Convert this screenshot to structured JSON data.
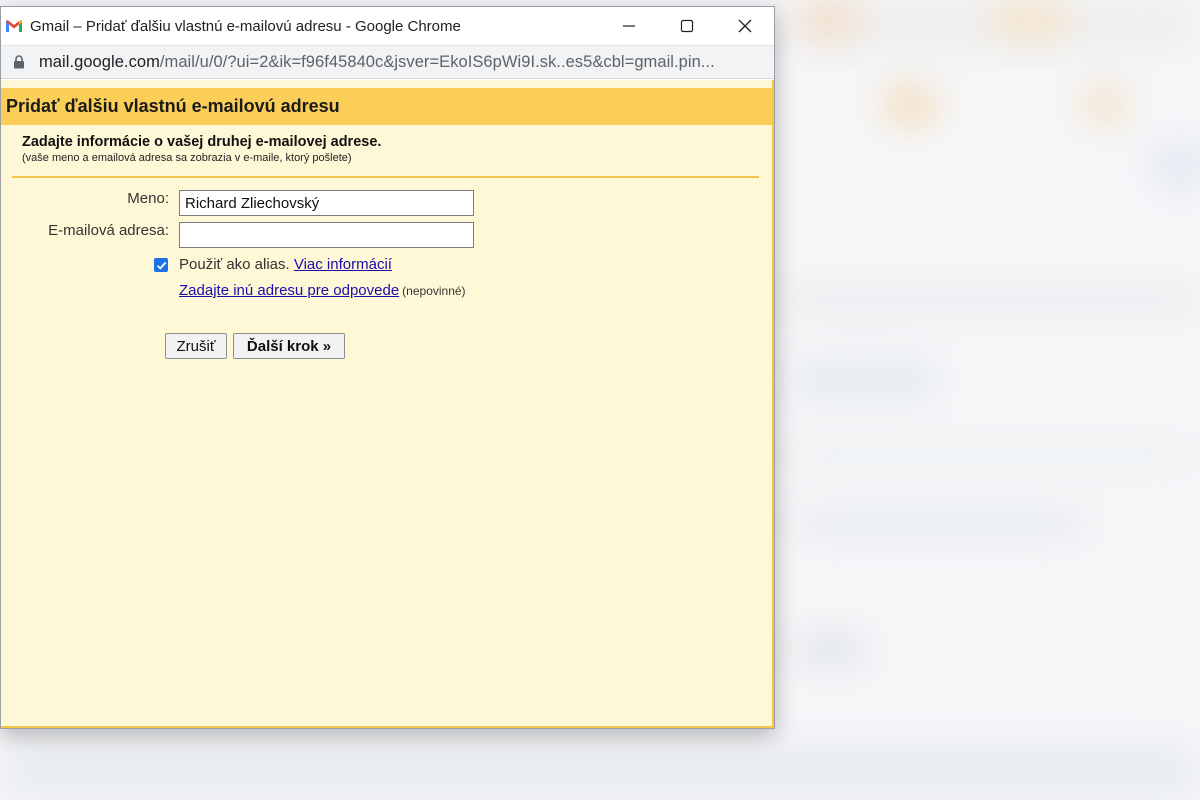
{
  "window": {
    "title": "Gmail – Pridať ďalšiu vlastnú e-mailovú adresu - Google Chrome",
    "url_host": "mail.google.com",
    "url_path": "/mail/u/0/?ui=2&ik=f96f45840c&jsver=EkoIS6pWi9I.sk..es5&cbl=gmail.pin...",
    "icons": [
      "gmail-icon",
      "minimize-icon",
      "maximize-icon",
      "close-icon",
      "lock-icon"
    ]
  },
  "dialog": {
    "header": "Pridať ďalšiu vlastnú e-mailovú adresu",
    "intro_title": "Zadajte informácie o vašej druhej e-mailovej adrese.",
    "intro_sub": "(vaše meno a emailová adresa sa zobrazia v e-maile, ktorý pošlete)",
    "name_label": "Meno:",
    "name_value": "Richard Zliechovský",
    "email_label": "E-mailová adresa:",
    "email_value": "",
    "alias_checked": true,
    "alias_label": "Použiť ako alias.",
    "alias_link": "Viac informácií",
    "reply_link": "Zadajte inú adresu pre odpovede",
    "reply_optional": "(nepovinné)",
    "cancel_label": "Zrušiť",
    "next_label": "Ďalší krok »"
  },
  "colors": {
    "header_bg": "#fbce57",
    "content_bg": "#fff8d6",
    "accent_border": "#f3c64a",
    "link": "#1a0dab",
    "checkbox": "#1a73e8"
  }
}
